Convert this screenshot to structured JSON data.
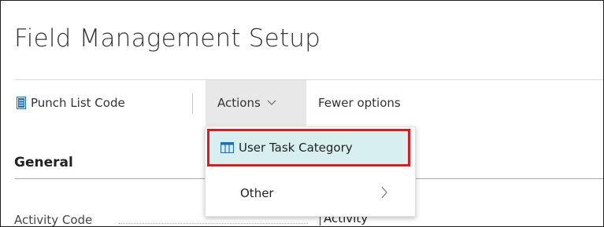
{
  "page": {
    "title": "Field Management Setup"
  },
  "action_bar": {
    "punch_list_label": "Punch List Code",
    "actions_label": "Actions",
    "fewer_options_label": "Fewer options"
  },
  "actions_menu": {
    "items": [
      {
        "label": "User Task Category",
        "icon": "grid-icon",
        "highlighted": true
      },
      {
        "label": "Other",
        "icon": "chevron-right-icon",
        "has_submenu": true
      }
    ]
  },
  "general": {
    "section_title": "General",
    "fields": [
      {
        "label": "Activity Code",
        "value": "Activity"
      }
    ]
  },
  "colors": {
    "highlight_border": "#e0191e",
    "highlight_fill": "#d7efee",
    "accent_blue": "#1f6fb5",
    "actions_button_bg": "#e8e8e8"
  }
}
